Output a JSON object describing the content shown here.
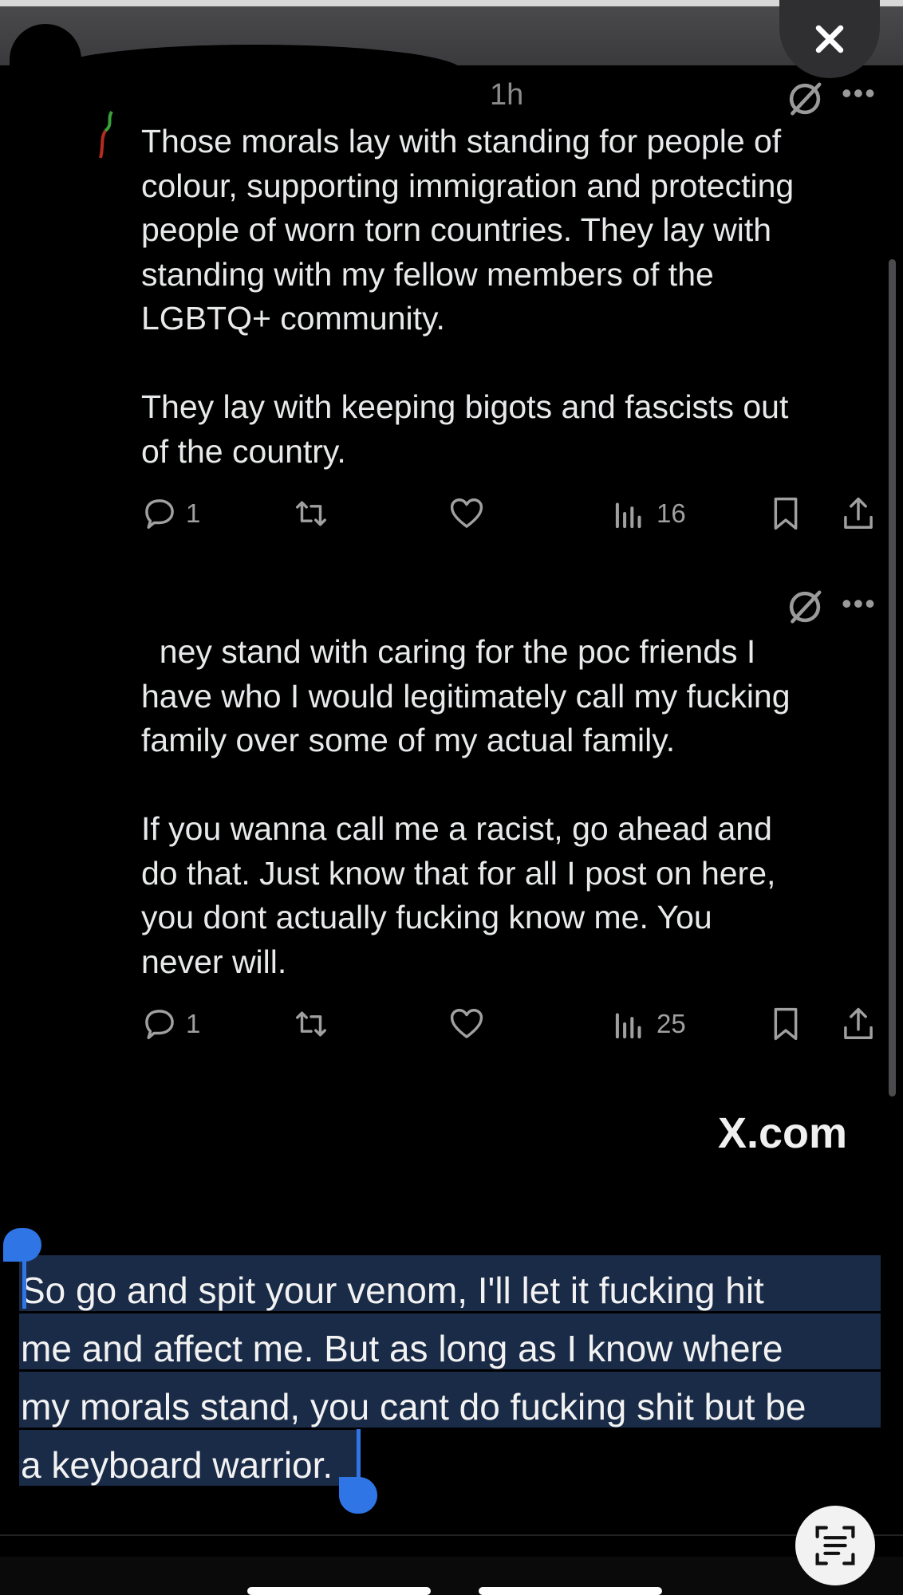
{
  "close_label": "Close",
  "posts": [
    {
      "time": "1h",
      "text": "Those morals lay with standing for people of\ncolour, supporting immigration and protecting\npeople of worn torn countries. They lay with\nstanding with my fellow members of the\nLGBTQ+ community.\n\nThey lay with keeping bigots and fascists out\nof the country.",
      "replies": "1",
      "reposts": "",
      "likes": "",
      "views": "16"
    },
    {
      "text": "  ney stand with caring for the poc friends I\nhave who I would legitimately call my fucking\nfamily over some of my actual family.\n\nIf you wanna call me a racist, go ahead and\ndo that. Just know that for all I post on here,\nyou dont actually fucking know me. You\nnever will.",
      "replies": "1",
      "reposts": "",
      "likes": "",
      "views": "25"
    }
  ],
  "brand": "X.com",
  "selected_text": "So go and spit your venom, I'll let it fucking hit\nme and affect me. But as long as I know where\nmy morals stand, you cant do fucking shit but be\na keyboard warrior.",
  "icons": {
    "close": "close-icon",
    "mute": "mute-icon",
    "more": "more-icon",
    "reply": "reply-icon",
    "repost": "repost-icon",
    "like": "heart-icon",
    "views": "views-icon",
    "bookmark": "bookmark-icon",
    "share": "share-icon",
    "scan": "text-scan-icon"
  },
  "colors": {
    "background": "#000000",
    "selection": "#1a2b47",
    "selection_handle": "#2f75e6",
    "muted_text": "#8b8b8b"
  }
}
